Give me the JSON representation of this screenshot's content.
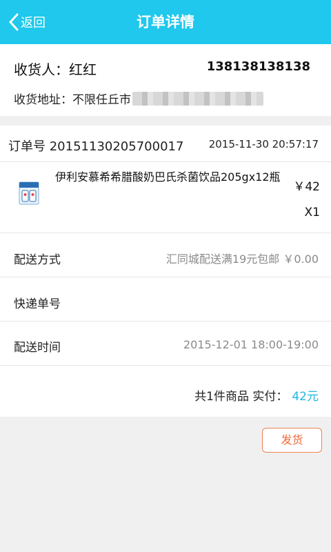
{
  "header": {
    "back_label": "返回",
    "title": "订单详情",
    "background_color": "#1fc8ec"
  },
  "address": {
    "receiver_label": "收货人：",
    "receiver_name": "红红",
    "phone": "138138138138",
    "address_label": "收货地址：",
    "address_text": "不限任丘市"
  },
  "order": {
    "number_label": "订单号",
    "number": "20151130205700017",
    "time": "2015-11-30 20:57:17",
    "product": {
      "name": "伊利安慕希希腊酸奶巴氏杀菌饮品205gx12瓶",
      "price": "￥42",
      "quantity": "X1",
      "thumb_icon": "yogurt-box-icon"
    },
    "shipping_method_label": "配送方式",
    "shipping_method_value": "汇同城配送满19元包邮  ￥0.00",
    "tracking_label": "快递单号",
    "tracking_value": "",
    "delivery_time_label": "配送时间",
    "delivery_time_value": "2015-12-01 18:00-19:00",
    "total_label": "共1件商品 实付：",
    "total_amount": "42元",
    "total_color": "#1fb8e0"
  },
  "actions": {
    "ship_label": "发货",
    "ship_color": "#f06a3a"
  }
}
